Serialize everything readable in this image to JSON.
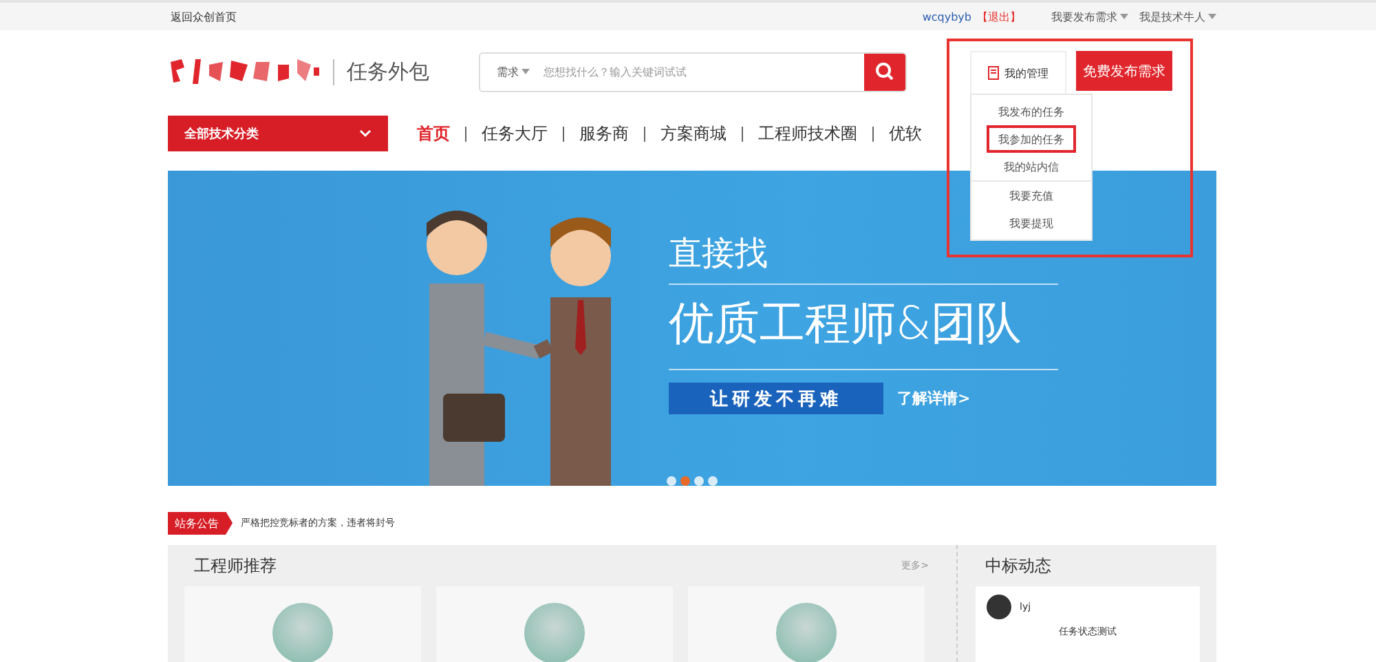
{
  "top_bar": {
    "home_link": "返回众创首页",
    "username": "wcqybyb",
    "logout": "【退出】",
    "menus": [
      "我要发布需求",
      "我是技术牛人"
    ]
  },
  "header": {
    "brand": "任务外包",
    "search": {
      "category": "需求",
      "placeholder": "您想找什么？输入关键词试试"
    },
    "management": {
      "label": "我的管理",
      "expanded": true,
      "groups": [
        [
          {
            "label": "我发布的任务",
            "highlighted": false
          },
          {
            "label": "我参加的任务",
            "highlighted": true
          },
          {
            "label": "我的站内信",
            "highlighted": false
          }
        ],
        [
          {
            "label": "我要充值",
            "highlighted": false
          },
          {
            "label": "我要提现",
            "highlighted": false
          }
        ]
      ]
    },
    "post_button": "免费发布需求"
  },
  "nav": {
    "category_button": "全部技术分类",
    "items": [
      {
        "label": "首页",
        "selected": true
      },
      {
        "label": "任务大厅",
        "selected": false
      },
      {
        "label": "服务商",
        "selected": false
      },
      {
        "label": "方案商城",
        "selected": false
      },
      {
        "label": "工程师技术圈",
        "selected": false
      },
      {
        "label": "优软",
        "selected": false
      }
    ]
  },
  "banner": {
    "headline": "直接找",
    "title": "优质工程师&团队",
    "slogan": "让研发不再难",
    "link": "了解详情>",
    "dots": [
      {
        "selected": false
      },
      {
        "selected": true
      },
      {
        "selected": false
      },
      {
        "selected": false
      }
    ]
  },
  "notice": {
    "tag": "站务公告",
    "text": "严格把控竞标者的方案，违者将封号"
  },
  "engineers": {
    "title": "工程师推荐",
    "more": "更多>",
    "cards": [
      {
        "photo": true
      },
      {
        "photo": true
      },
      {
        "photo": true
      }
    ]
  },
  "bids": {
    "title": "中标动态",
    "items": [
      {
        "user": "lyj",
        "task": "任务状态测试"
      }
    ]
  }
}
